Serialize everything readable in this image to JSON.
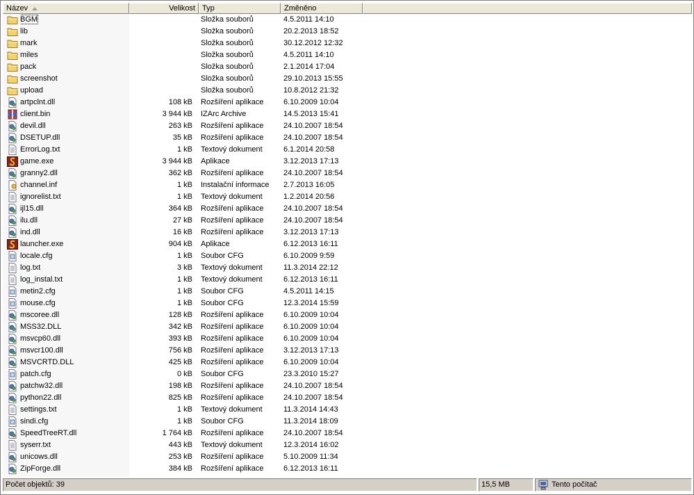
{
  "columns": {
    "name": "Název",
    "size": "Velikost",
    "type": "Typ",
    "modified": "Změněno"
  },
  "files": [
    {
      "name": "BGM",
      "size": "",
      "type": "Složka souborů",
      "modified": "4.5.2011 14:10",
      "icon": "folder-icon"
    },
    {
      "name": "lib",
      "size": "",
      "type": "Složka souborů",
      "modified": "20.2.2013 18:52",
      "icon": "folder-icon"
    },
    {
      "name": "mark",
      "size": "",
      "type": "Složka souborů",
      "modified": "30.12.2012 12:32",
      "icon": "folder-icon"
    },
    {
      "name": "miles",
      "size": "",
      "type": "Složka souborů",
      "modified": "4.5.2011 14:10",
      "icon": "folder-icon"
    },
    {
      "name": "pack",
      "size": "",
      "type": "Složka souborů",
      "modified": "2.1.2014 17:04",
      "icon": "folder-icon"
    },
    {
      "name": "screenshot",
      "size": "",
      "type": "Složka souborů",
      "modified": "29.10.2013 15:55",
      "icon": "folder-icon"
    },
    {
      "name": "upload",
      "size": "",
      "type": "Složka souborů",
      "modified": "10.8.2012 21:32",
      "icon": "folder-icon"
    },
    {
      "name": "artpclnt.dll",
      "size": "108 kB",
      "type": "Rozšíření aplikace",
      "modified": "6.10.2009 10:04",
      "icon": "dll-icon"
    },
    {
      "name": "client.bin",
      "size": "3 944 kB",
      "type": "IZArc Archive",
      "modified": "14.5.2013 15:41",
      "icon": "archive-icon"
    },
    {
      "name": "devil.dll",
      "size": "263 kB",
      "type": "Rozšíření aplikace",
      "modified": "24.10.2007 18:54",
      "icon": "dll-icon"
    },
    {
      "name": "DSETUP.dll",
      "size": "35 kB",
      "type": "Rozšíření aplikace",
      "modified": "24.10.2007 18:54",
      "icon": "dll-icon"
    },
    {
      "name": "ErrorLog.txt",
      "size": "1 kB",
      "type": "Textový dokument",
      "modified": "6.1.2014 20:58",
      "icon": "text-file-icon"
    },
    {
      "name": "game.exe",
      "size": "3 944 kB",
      "type": "Aplikace",
      "modified": "3.12.2013 17:13",
      "icon": "app-icon"
    },
    {
      "name": "granny2.dll",
      "size": "362 kB",
      "type": "Rozšíření aplikace",
      "modified": "24.10.2007 18:54",
      "icon": "dll-icon"
    },
    {
      "name": "channel.inf",
      "size": "1 kB",
      "type": "Instalační informace",
      "modified": "2.7.2013 16:05",
      "icon": "inf-icon"
    },
    {
      "name": "ignorelist.txt",
      "size": "1 kB",
      "type": "Textový dokument",
      "modified": "1.2.2014 20:56",
      "icon": "text-file-icon"
    },
    {
      "name": "ijl15.dll",
      "size": "364 kB",
      "type": "Rozšíření aplikace",
      "modified": "24.10.2007 18:54",
      "icon": "dll-icon"
    },
    {
      "name": "ilu.dll",
      "size": "27 kB",
      "type": "Rozšíření aplikace",
      "modified": "24.10.2007 18:54",
      "icon": "dll-icon"
    },
    {
      "name": "ind.dll",
      "size": "16 kB",
      "type": "Rozšíření aplikace",
      "modified": "3.12.2013 17:13",
      "icon": "dll-icon"
    },
    {
      "name": "launcher.exe",
      "size": "904 kB",
      "type": "Aplikace",
      "modified": "6.12.2013 16:11",
      "icon": "app-icon"
    },
    {
      "name": "locale.cfg",
      "size": "1 kB",
      "type": "Soubor CFG",
      "modified": "6.10.2009 9:59",
      "icon": "cfg-icon"
    },
    {
      "name": "log.txt",
      "size": "3 kB",
      "type": "Textový dokument",
      "modified": "11.3.2014 22:12",
      "icon": "text-file-icon"
    },
    {
      "name": "log_instal.txt",
      "size": "1 kB",
      "type": "Textový dokument",
      "modified": "6.12.2013 16:11",
      "icon": "text-file-icon"
    },
    {
      "name": "metin2.cfg",
      "size": "1 kB",
      "type": "Soubor CFG",
      "modified": "4.5.2011 14:15",
      "icon": "cfg-icon"
    },
    {
      "name": "mouse.cfg",
      "size": "1 kB",
      "type": "Soubor CFG",
      "modified": "12.3.2014 15:59",
      "icon": "cfg-icon"
    },
    {
      "name": "mscoree.dll",
      "size": "128 kB",
      "type": "Rozšíření aplikace",
      "modified": "6.10.2009 10:04",
      "icon": "dll-icon"
    },
    {
      "name": "MSS32.DLL",
      "size": "342 kB",
      "type": "Rozšíření aplikace",
      "modified": "6.10.2009 10:04",
      "icon": "dll-icon"
    },
    {
      "name": "msvcp60.dll",
      "size": "393 kB",
      "type": "Rozšíření aplikace",
      "modified": "6.10.2009 10:04",
      "icon": "dll-icon"
    },
    {
      "name": "msvcr100.dll",
      "size": "756 kB",
      "type": "Rozšíření aplikace",
      "modified": "3.12.2013 17:13",
      "icon": "dll-icon"
    },
    {
      "name": "MSVCRTD.DLL",
      "size": "425 kB",
      "type": "Rozšíření aplikace",
      "modified": "6.10.2009 10:04",
      "icon": "dll-icon"
    },
    {
      "name": "patch.cfg",
      "size": "0 kB",
      "type": "Soubor CFG",
      "modified": "23.3.2010 15:27",
      "icon": "cfg-icon"
    },
    {
      "name": "patchw32.dll",
      "size": "198 kB",
      "type": "Rozšíření aplikace",
      "modified": "24.10.2007 18:54",
      "icon": "dll-icon"
    },
    {
      "name": "python22.dll",
      "size": "825 kB",
      "type": "Rozšíření aplikace",
      "modified": "24.10.2007 18:54",
      "icon": "dll-icon"
    },
    {
      "name": "settings.txt",
      "size": "1 kB",
      "type": "Textový dokument",
      "modified": "11.3.2014 14:43",
      "icon": "text-file-icon"
    },
    {
      "name": "sindi.cfg",
      "size": "1 kB",
      "type": "Soubor CFG",
      "modified": "11.3.2014 18:09",
      "icon": "cfg-icon"
    },
    {
      "name": "SpeedTreeRT.dll",
      "size": "1 764 kB",
      "type": "Rozšíření aplikace",
      "modified": "24.10.2007 18:54",
      "icon": "dll-icon"
    },
    {
      "name": "syserr.txt",
      "size": "443 kB",
      "type": "Textový dokument",
      "modified": "12.3.2014 16:02",
      "icon": "text-file-icon"
    },
    {
      "name": "unicows.dll",
      "size": "253 kB",
      "type": "Rozšíření aplikace",
      "modified": "5.10.2009 11:34",
      "icon": "dll-icon"
    },
    {
      "name": "ZipForge.dll",
      "size": "384 kB",
      "type": "Rozšíření aplikace",
      "modified": "6.12.2013 16:11",
      "icon": "dll-icon"
    }
  ],
  "status": {
    "count": "Počet objektů: 39",
    "size": "15,5 MB",
    "location": "Tento počítač"
  },
  "colors": {
    "folder": "#f4d36b",
    "header_bg": "#ece9d8",
    "status_bg": "#d4d0c8"
  }
}
